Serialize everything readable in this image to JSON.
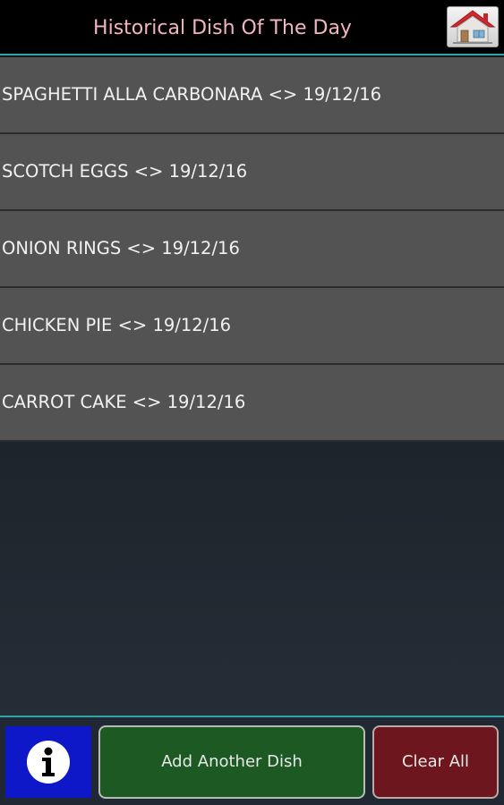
{
  "header": {
    "title": "Historical Dish Of The Day",
    "home_icon": "home-icon"
  },
  "dishes": [
    {
      "label": "SPAGHETTI ALLA CARBONARA <> 19/12/16"
    },
    {
      "label": "SCOTCH EGGS <> 19/12/16"
    },
    {
      "label": "ONION RINGS <> 19/12/16"
    },
    {
      "label": "CHICKEN PIE <> 19/12/16"
    },
    {
      "label": "CARROT CAKE <> 19/12/16"
    }
  ],
  "footer": {
    "info_icon": "info-icon",
    "add_label": "Add Another Dish",
    "clear_label": "Clear All"
  },
  "colors": {
    "header_bg": "#000000",
    "title_color": "#f3b5c2",
    "accent_line": "#2fa6a6",
    "list_item_bg": "#535353",
    "info_button_bg": "#0f18c9",
    "add_button_bg": "#1d5a23",
    "clear_button_bg": "#6e161d"
  }
}
